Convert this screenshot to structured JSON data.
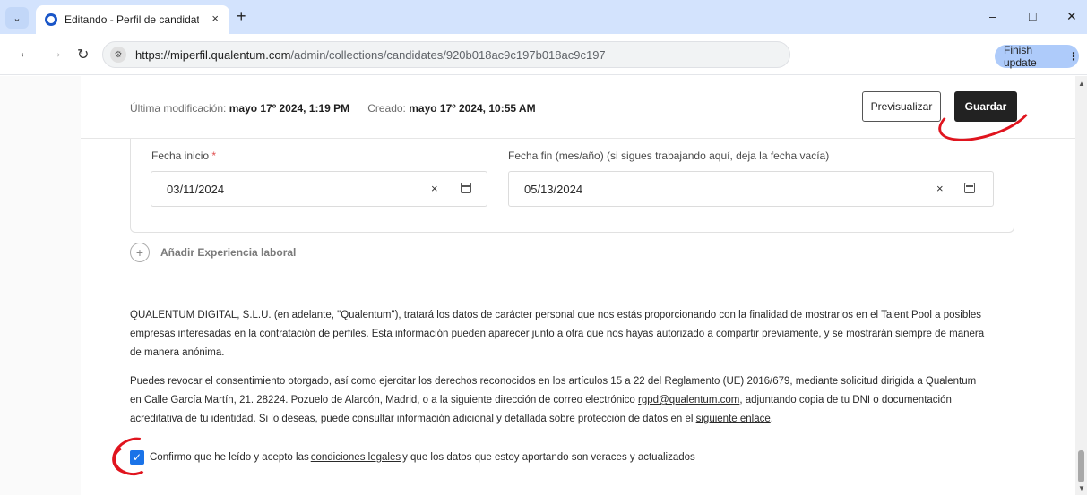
{
  "browser": {
    "tab_title": "Editando - Perfil de candidato -",
    "tab_close": "×",
    "new_tab": "+",
    "url_host": "https://miperfil.qualentum.com",
    "url_path": "/admin/collections/candidates/920b018ac9c197b018ac9c197",
    "finish_update": "Finish update",
    "minimize": "–",
    "maximize": "□",
    "close": "✕"
  },
  "meta": {
    "modified_label": "Última modificación:",
    "modified_value": "mayo 17º 2024, 1:19 PM",
    "created_label": "Creado:",
    "created_value": "mayo 17º 2024, 10:55 AM"
  },
  "actions": {
    "preview": "Previsualizar",
    "save": "Guardar"
  },
  "experience": {
    "start_label": "Fecha inicio",
    "required_mark": "*",
    "start_value": "03/11/2024",
    "end_label": "Fecha fin (mes/año) (si sigues trabajando aquí, deja la fecha vacía)",
    "end_value": "05/13/2024",
    "clear_glyph": "×",
    "add_label": "Añadir Experiencia laboral",
    "add_glyph": "+"
  },
  "legal": {
    "p1": "QUALENTUM DIGITAL, S.L.U. (en adelante, \"Qualentum\"), tratará los datos de carácter personal que nos estás proporcionando con la finalidad de mostrarlos en el Talent Pool a posibles empresas interesadas en la contratación de perfiles. Esta información pueden aparecer junto a otra que nos hayas autorizado a compartir previamente, y se mostrarán siempre de manera de manera anónima.",
    "p2_a": "Puedes revocar el consentimiento otorgado, así como ejercitar los derechos reconocidos en los artículos 15 a 22 del Reglamento (UE) 2016/679, mediante solicitud dirigida a Qualentum en Calle García Martín, 21. 28224. Pozuelo de Alarcón, Madrid, o a la siguiente dirección de correo electrónico ",
    "p2_email": "rgpd@qualentum.com",
    "p2_b": ", adjuntando copia de tu DNI o documentación acreditativa de tu identidad. Si lo deseas, puede consultar información adicional y detallada sobre protección de datos en el ",
    "p2_link": "siguiente enlace",
    "p2_c": "."
  },
  "consent": {
    "checked": true,
    "check_glyph": "✓",
    "text_a": "Confirmo que he leído y acepto las ",
    "link": "condiciones legales",
    "text_b": " y que los datos que estoy aportando son veraces y actualizados"
  },
  "colors": {
    "accent": "#1a73e8",
    "annotation": "#e0141e",
    "save_bg": "#222222"
  }
}
